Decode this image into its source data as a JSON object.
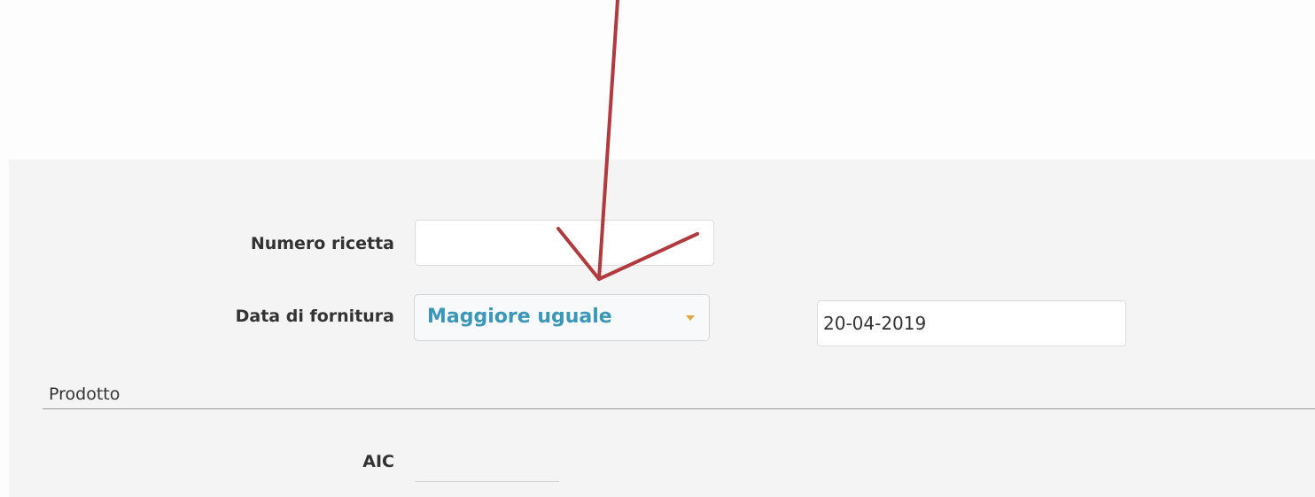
{
  "form": {
    "numero_ricetta": {
      "label": "Numero ricetta",
      "value": ""
    },
    "data_fornitura": {
      "label": "Data di fornitura",
      "operator": "Maggiore uguale",
      "date_value": "20-04-2019"
    },
    "section": {
      "title": "Prodotto"
    },
    "aic": {
      "label": "AIC",
      "value": ""
    }
  },
  "annotation": {
    "color": "#b03a3e"
  },
  "colors": {
    "select_text": "#3a97b8",
    "caret": "#e8a53d",
    "panel_background": "#f4f4f4"
  }
}
